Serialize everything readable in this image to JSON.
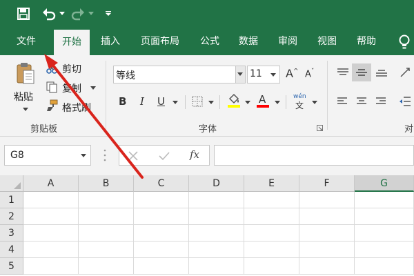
{
  "quick_access": {
    "save_icon": "save-icon",
    "undo_icon": "undo-icon",
    "redo_icon": "redo-icon",
    "customize_icon": "customize-qat-icon"
  },
  "tabs": [
    {
      "label": "文件"
    },
    {
      "label": "开始"
    },
    {
      "label": "插入"
    },
    {
      "label": "页面布局"
    },
    {
      "label": "公式"
    },
    {
      "label": "数据"
    },
    {
      "label": "审阅"
    },
    {
      "label": "视图"
    },
    {
      "label": "帮助"
    }
  ],
  "ribbon": {
    "clipboard": {
      "paste_label": "粘贴",
      "cut_label": "剪切",
      "copy_label": "复制",
      "format_painter_label": "格式刷",
      "group_label": "剪贴板"
    },
    "font": {
      "font_name": "等线",
      "font_size": "11",
      "bold": "B",
      "italic": "I",
      "underline": "U",
      "phonetic_top": "wén",
      "phonetic_bottom": "文",
      "group_label": "字体"
    },
    "alignment": {
      "group_label_partial": "对"
    }
  },
  "formula_bar": {
    "name_box": "G8",
    "fx_label": "fx"
  },
  "grid": {
    "columns": [
      "A",
      "B",
      "C",
      "D",
      "E",
      "F",
      "G"
    ],
    "rows": [
      "1",
      "2",
      "3",
      "4",
      "5"
    ],
    "selected_column": "G"
  },
  "colors": {
    "brand_green": "#217346",
    "annotation_red": "#d9241c",
    "font_highlight_yellow": "#ffff00",
    "font_color_red": "#ff0000"
  }
}
